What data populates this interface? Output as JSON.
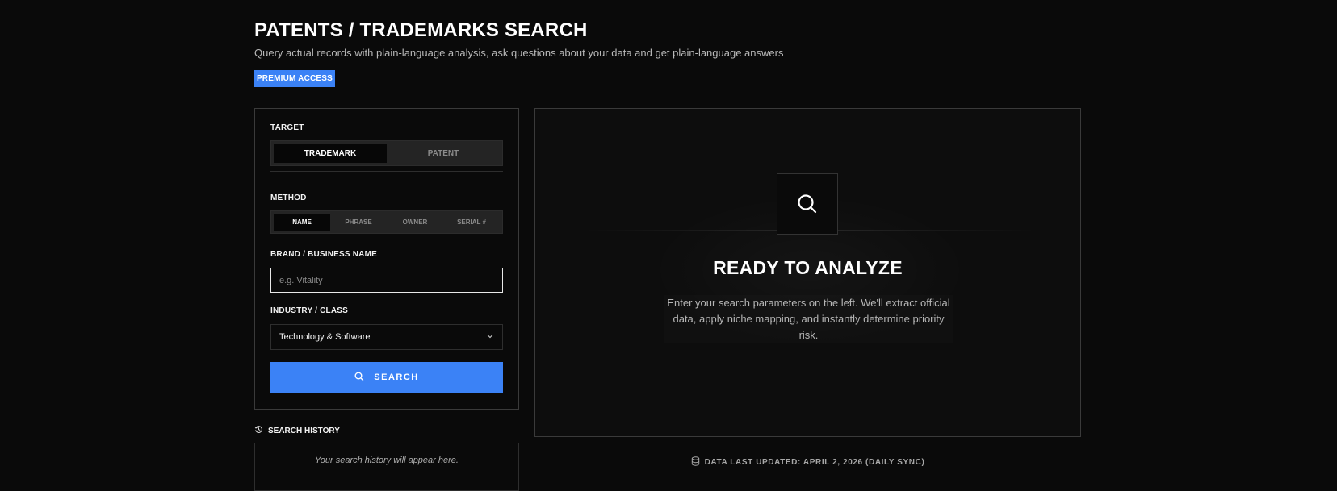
{
  "header": {
    "title": "PATENTS / TRADEMARKS SEARCH",
    "subtitle": "Query actual records with plain-language analysis, ask questions about your data and get plain-language answers",
    "badge": "PREMIUM ACCESS"
  },
  "form": {
    "target_label": "TARGET",
    "target_options": [
      "TRADEMARK",
      "PATENT"
    ],
    "target_selected": "TRADEMARK",
    "method_label": "METHOD",
    "method_options": [
      "NAME",
      "PHRASE",
      "OWNER",
      "SERIAL #"
    ],
    "method_selected": "NAME",
    "brand_label": "BRAND / BUSINESS NAME",
    "brand_placeholder": "e.g. Vitality",
    "brand_value": "",
    "industry_label": "INDUSTRY / CLASS",
    "industry_value": "Technology & Software",
    "search_button": "SEARCH"
  },
  "history": {
    "title": "SEARCH HISTORY",
    "empty_text": "Your search history will appear here."
  },
  "result": {
    "title": "READY TO ANALYZE",
    "description": "Enter your search parameters on the left. We'll extract official data, apply niche mapping, and instantly determine priority risk."
  },
  "footer": {
    "updated_text": "DATA LAST UPDATED: APRIL 2, 2026 (DAILY SYNC)"
  },
  "icons": {
    "search": "search-icon",
    "history": "history-icon",
    "database": "database-icon",
    "chevron": "chevron-down-icon"
  },
  "colors": {
    "background": "#0a0a0a",
    "accent": "#3b82f6",
    "border": "#3a3a3a"
  }
}
